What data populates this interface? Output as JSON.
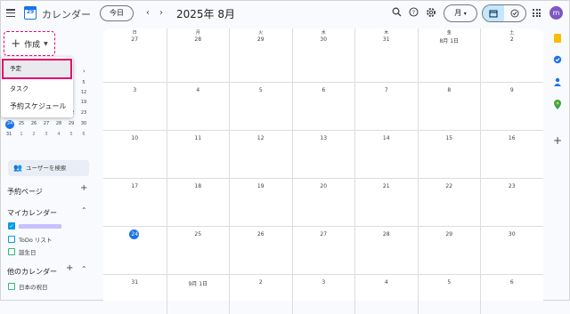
{
  "header": {
    "app_title": "カレンダー",
    "logo_text": "29",
    "today_label": "今日",
    "month_title": "2025年 8月",
    "view_label": "月",
    "avatar_letter": "m"
  },
  "create": {
    "label": "作成"
  },
  "dropdown": {
    "items": [
      "予定",
      "タスク",
      "予約スケジュール"
    ]
  },
  "mini_calendar": {
    "next_icon": "›",
    "rows": [
      [
        "",
        "",
        "",
        "",
        "",
        "",
        "5"
      ],
      [
        "",
        "",
        "",
        "",
        "",
        "",
        "12"
      ],
      [
        "",
        "",
        "",
        "",
        "",
        "",
        "19"
      ],
      [
        "17",
        "18",
        "19",
        "20",
        "21",
        "22",
        "23"
      ],
      [
        "24",
        "25",
        "26",
        "27",
        "28",
        "29",
        "30"
      ],
      [
        "31",
        "1",
        "2",
        "3",
        "4",
        "5",
        "6"
      ]
    ]
  },
  "sidebar": {
    "user_search": "ユーザーを検索",
    "booking_pages": "予約ページ",
    "my_calendars": "マイカレンダー",
    "my_calendar_items": [
      "",
      "ToDo リスト",
      "誕生日"
    ],
    "other_calendars": "他のカレンダー",
    "other_calendar_items": [
      "日本の祝日"
    ]
  },
  "calendar": {
    "weekdays": [
      "日",
      "月",
      "火",
      "水",
      "木",
      "金",
      "土"
    ],
    "weeks": [
      [
        "27",
        "28",
        "29",
        "30",
        "31",
        "8月 1日",
        "2"
      ],
      [
        "3",
        "4",
        "5",
        "6",
        "7",
        "8",
        "9"
      ],
      [
        "10",
        "11",
        "12",
        "13",
        "14",
        "15",
        "16"
      ],
      [
        "17",
        "18",
        "19",
        "20",
        "21",
        "22",
        "23"
      ],
      [
        "24",
        "25",
        "26",
        "27",
        "28",
        "29",
        "30"
      ],
      [
        "31",
        "9月 1日",
        "2",
        "3",
        "4",
        "5",
        "6"
      ]
    ],
    "today": "24"
  },
  "colors": {
    "accent": "#1a73e8",
    "highlight": "#e6007e"
  }
}
